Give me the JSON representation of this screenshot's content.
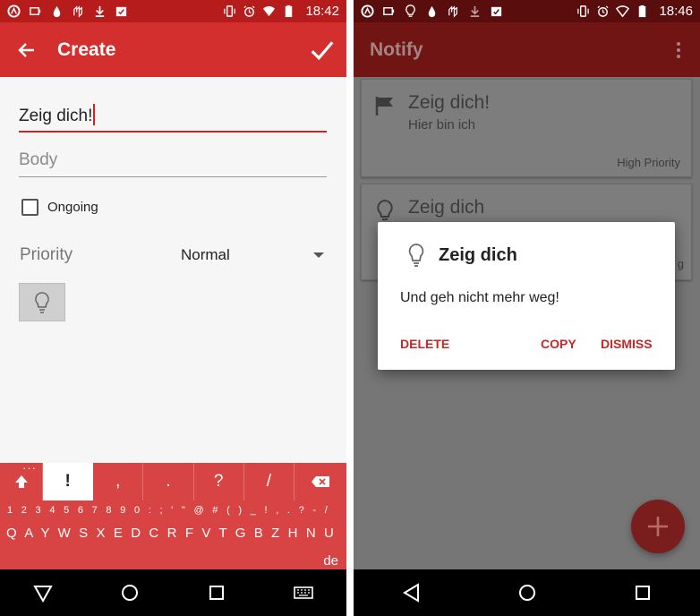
{
  "left_screen": {
    "status_bar": {
      "time": "18:42",
      "left_icons": [
        "opera-icon",
        "cast-icon",
        "drop-icon",
        "gesture-icon",
        "download-icon",
        "checklist-icon"
      ],
      "right_icons": [
        "vibrate-icon",
        "alarm-icon",
        "wifi-icon",
        "battery-icon"
      ],
      "battery_level": "89"
    },
    "app_bar": {
      "title": "Create"
    },
    "form": {
      "title_value": "Zeig dich!",
      "body_placeholder": "Body",
      "ongoing_label": "Ongoing",
      "priority_label": "Priority",
      "priority_value": "Normal"
    },
    "keyboard": {
      "top_keys": [
        "!",
        ",",
        ".",
        "?",
        "/"
      ],
      "symbols_row": "1 2 3 4 5 6 7 8 9 0 : ; ' \" @ # ( ) _ ! , . ? - /",
      "letters_row": "Q A Y W S X E D C R F V T G B Z H N U J M I K O L P",
      "language": "de"
    }
  },
  "right_screen": {
    "status_bar": {
      "time": "18:46",
      "left_icons": [
        "opera-icon",
        "cast-icon",
        "bulb-icon",
        "drop-icon",
        "gesture-icon",
        "download-icon",
        "checklist-icon"
      ],
      "right_icons": [
        "vibrate-icon",
        "alarm-icon",
        "wifi-icon",
        "battery-icon"
      ],
      "battery_level": "86"
    },
    "app_bar": {
      "title": "Notify"
    },
    "cards": [
      {
        "title": "Zeig dich!",
        "subtitle": "Hier bin ich",
        "priority": "High Priority",
        "icon": "flag-icon"
      },
      {
        "title": "Zeig dich",
        "subtitle": "",
        "priority": "g",
        "icon": "bulb-icon"
      }
    ],
    "dialog": {
      "title": "Zeig dich",
      "message": "Und geh nicht mehr weg!",
      "delete_label": "DELETE",
      "copy_label": "COPY",
      "dismiss_label": "DISMISS"
    }
  },
  "colors": {
    "accent": "#d32f2f",
    "status_bar": "#b71c1c",
    "dialog_button": "#c62828"
  }
}
